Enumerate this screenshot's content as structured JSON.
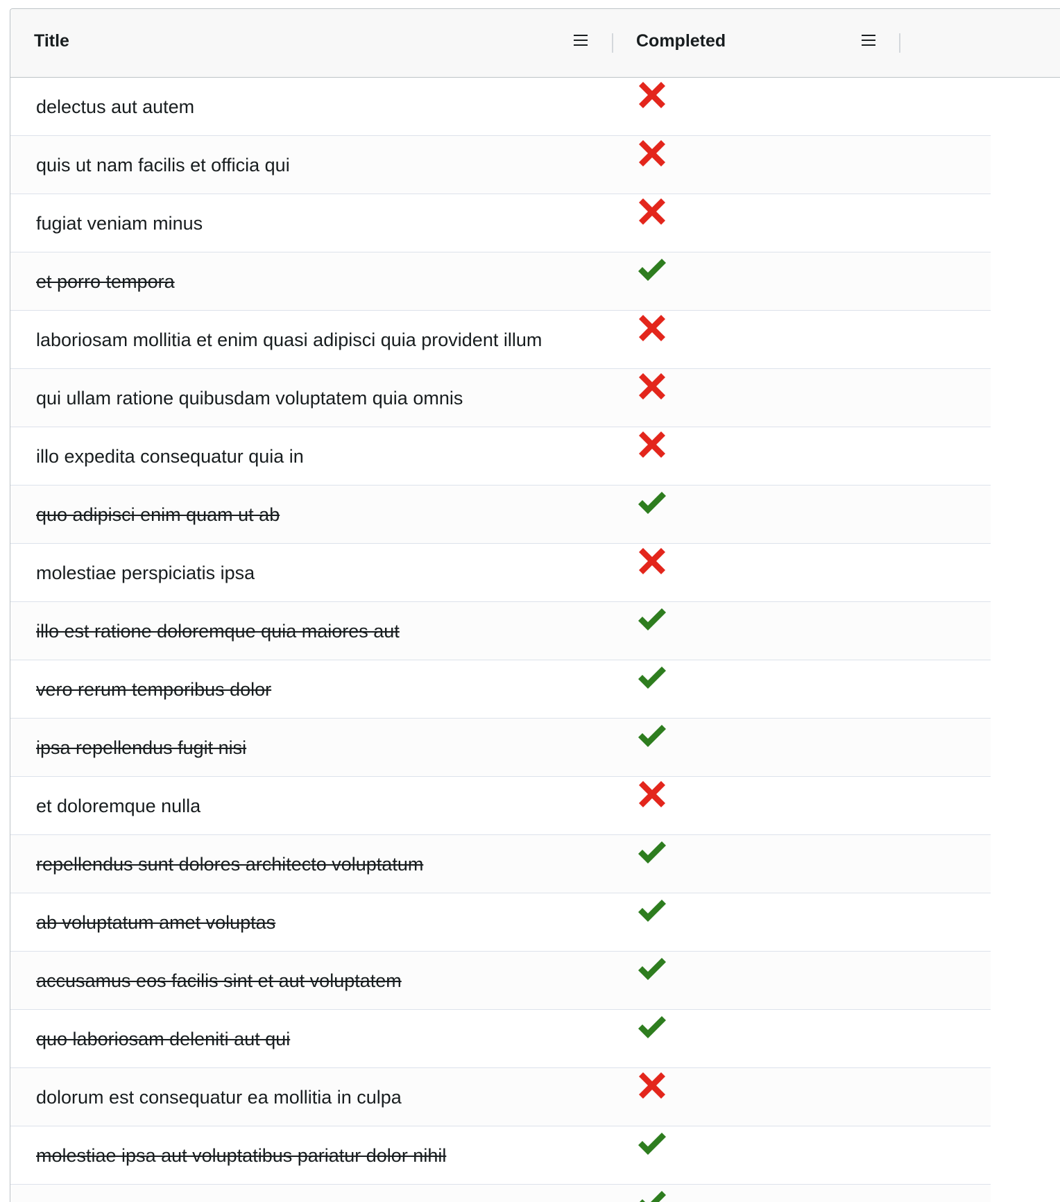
{
  "columns": {
    "title": {
      "label": "Title",
      "menu_icon": "menu-icon"
    },
    "completed": {
      "label": "Completed",
      "menu_icon": "menu-icon"
    }
  },
  "colors": {
    "check": "#2e7d1f",
    "cross": "#e3261c",
    "header_bg": "#f8f8f8",
    "text": "#181d1f"
  },
  "rows": [
    {
      "title": "delectus aut autem",
      "completed": false
    },
    {
      "title": "quis ut nam facilis et officia qui",
      "completed": false
    },
    {
      "title": "fugiat veniam minus",
      "completed": false
    },
    {
      "title": "et porro tempora",
      "completed": true
    },
    {
      "title": "laboriosam mollitia et enim quasi adipisci quia provident illum",
      "completed": false
    },
    {
      "title": "qui ullam ratione quibusdam voluptatem quia omnis",
      "completed": false
    },
    {
      "title": "illo expedita consequatur quia in",
      "completed": false
    },
    {
      "title": "quo adipisci enim quam ut ab",
      "completed": true
    },
    {
      "title": "molestiae perspiciatis ipsa",
      "completed": false
    },
    {
      "title": "illo est ratione doloremque quia maiores aut",
      "completed": true
    },
    {
      "title": "vero rerum temporibus dolor",
      "completed": true
    },
    {
      "title": "ipsa repellendus fugit nisi",
      "completed": true
    },
    {
      "title": "et doloremque nulla",
      "completed": false
    },
    {
      "title": "repellendus sunt dolores architecto voluptatum",
      "completed": true
    },
    {
      "title": "ab voluptatum amet voluptas",
      "completed": true
    },
    {
      "title": "accusamus eos facilis sint et aut voluptatem",
      "completed": true
    },
    {
      "title": "quo laboriosam deleniti aut qui",
      "completed": true
    },
    {
      "title": "dolorum est consequatur ea mollitia in culpa",
      "completed": false
    },
    {
      "title": "molestiae ipsa aut voluptatibus pariatur dolor nihil",
      "completed": true
    },
    {
      "title": "",
      "completed": true
    }
  ]
}
